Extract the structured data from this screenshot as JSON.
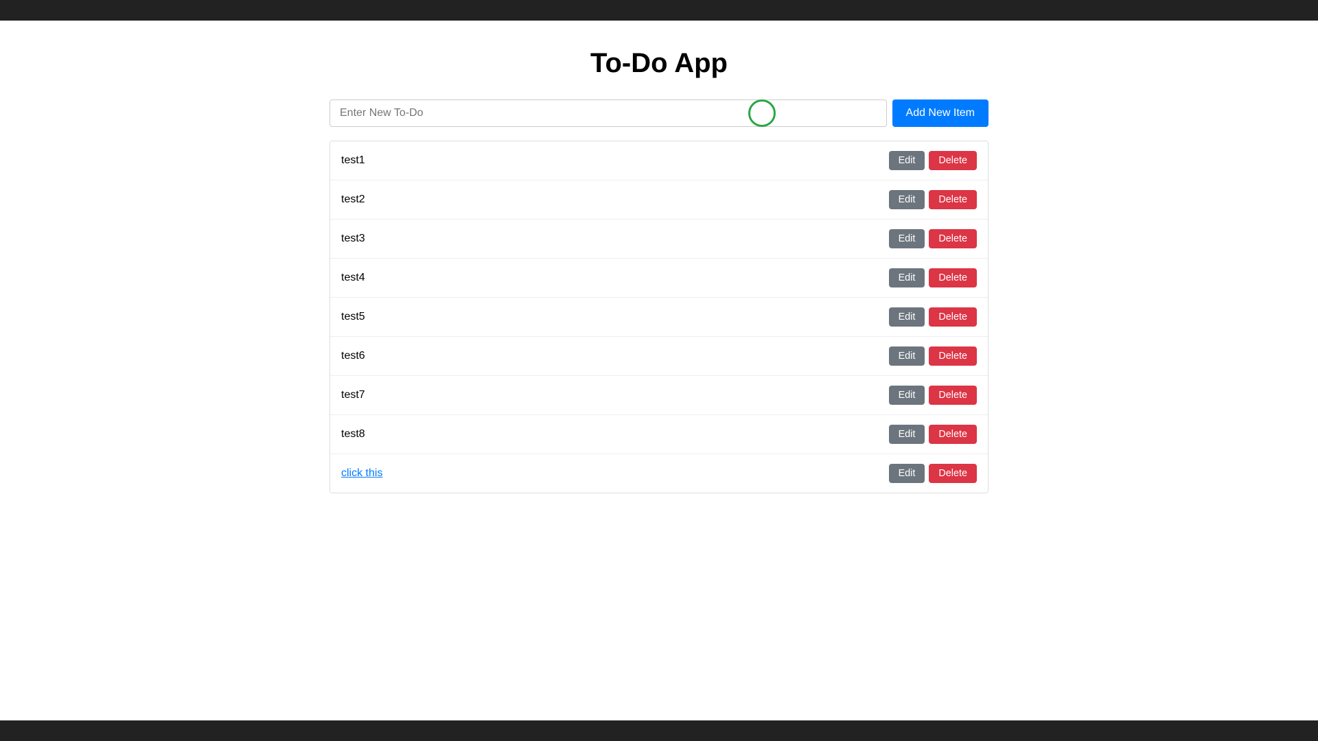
{
  "app": {
    "title": "To-Do App"
  },
  "input": {
    "placeholder": "Enter New To-Do",
    "value": ""
  },
  "add_button": {
    "label": "Add New Item"
  },
  "todo_items": [
    {
      "id": 1,
      "text": "test1",
      "is_link": false
    },
    {
      "id": 2,
      "text": "test2",
      "is_link": false
    },
    {
      "id": 3,
      "text": "test3",
      "is_link": false
    },
    {
      "id": 4,
      "text": "test4",
      "is_link": false
    },
    {
      "id": 5,
      "text": "test5",
      "is_link": false
    },
    {
      "id": 6,
      "text": "test6",
      "is_link": false
    },
    {
      "id": 7,
      "text": "test7",
      "is_link": false
    },
    {
      "id": 8,
      "text": "test8",
      "is_link": false
    },
    {
      "id": 9,
      "text": "click this",
      "is_link": true
    }
  ],
  "buttons": {
    "edit_label": "Edit",
    "delete_label": "Delete"
  }
}
